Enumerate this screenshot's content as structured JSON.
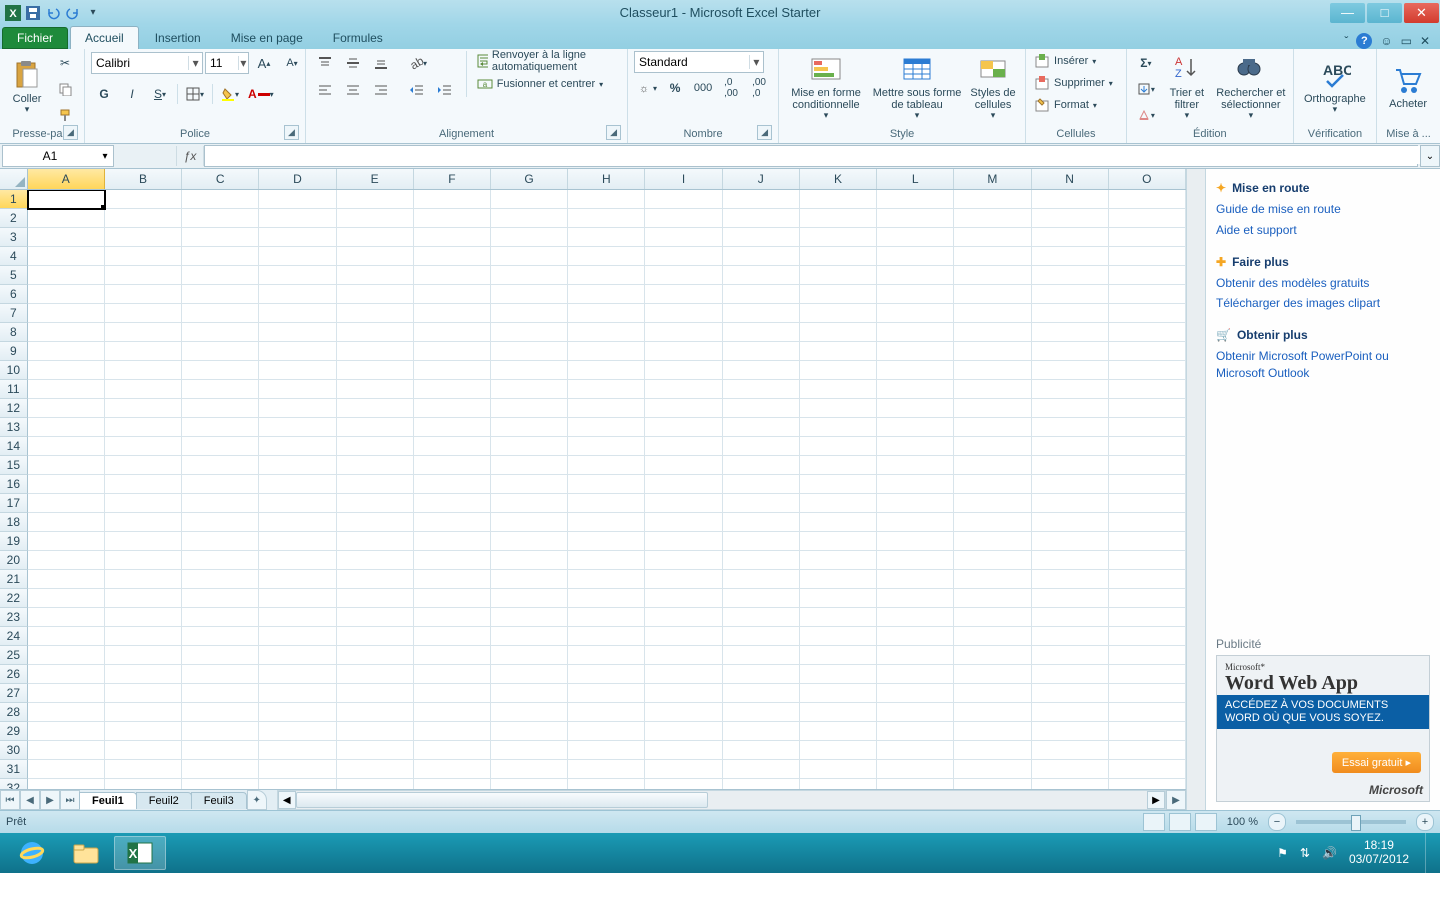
{
  "title": "Classeur1 - Microsoft Excel Starter",
  "tabs": {
    "file": "Fichier",
    "home": "Accueil",
    "insert": "Insertion",
    "layout": "Mise en page",
    "formulas": "Formules"
  },
  "ribbon": {
    "clipboard": {
      "label": "Presse-pa...",
      "paste": "Coller"
    },
    "font": {
      "label": "Police",
      "name": "Calibri",
      "size": "11"
    },
    "alignment": {
      "label": "Alignement",
      "wrap": "Renvoyer à la ligne automatiquement",
      "merge": "Fusionner et centrer"
    },
    "number": {
      "label": "Nombre",
      "format": "Standard"
    },
    "style": {
      "label": "Style",
      "cond": "Mise en forme conditionnelle",
      "table": "Mettre sous forme de tableau",
      "cell": "Styles de cellules"
    },
    "cells": {
      "label": "Cellules",
      "insert": "Insérer",
      "delete": "Supprimer",
      "format": "Format"
    },
    "editing": {
      "label": "Édition",
      "sort": "Trier et filtrer",
      "find": "Rechercher et sélectionner"
    },
    "proof": {
      "label": "Vérification",
      "spell": "Orthographe"
    },
    "upgrade": {
      "label": "Mise à ...",
      "buy": "Acheter"
    }
  },
  "namebox": "A1",
  "columns": [
    "A",
    "B",
    "C",
    "D",
    "E",
    "F",
    "G",
    "H",
    "I",
    "J",
    "K",
    "L",
    "M",
    "N",
    "O"
  ],
  "rowCount": 32,
  "sheets": [
    "Feuil1",
    "Feuil2",
    "Feuil3"
  ],
  "sidepanel": {
    "h1": "Mise en route",
    "l1": "Guide de mise en route",
    "l2": "Aide et support",
    "h2": "Faire plus",
    "l3": "Obtenir des modèles gratuits",
    "l4": "Télécharger des images clipart",
    "h3": "Obtenir plus",
    "l5": "Obtenir Microsoft PowerPoint ou Microsoft Outlook",
    "adlabel": "Publicité",
    "ad_brand_small": "Microsoft*",
    "ad_brand": "Word Web App",
    "ad_text": "ACCÉDEZ À VOS DOCUMENTS WORD OÙ QUE VOUS SOYEZ.",
    "ad_cta": "Essai gratuit",
    "ad_ms": "Microsoft"
  },
  "status": {
    "ready": "Prêt",
    "zoom": "100 %"
  },
  "taskbar": {
    "time": "18:19",
    "date": "03/07/2012"
  }
}
